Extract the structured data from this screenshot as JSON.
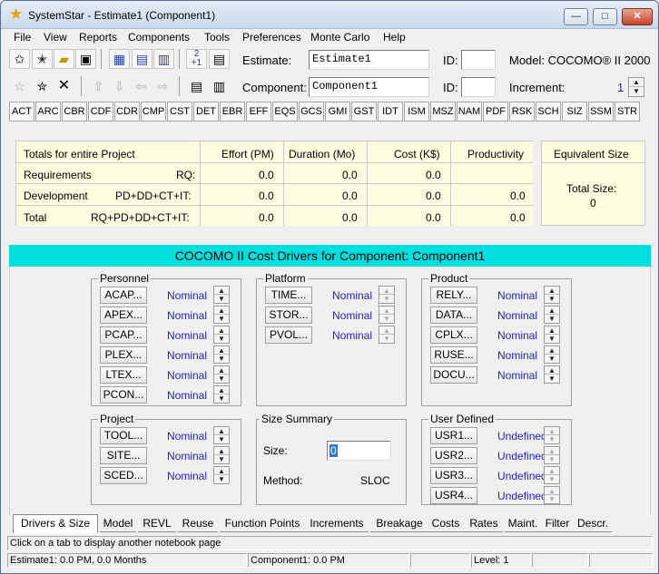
{
  "window": {
    "title": "SystemStar - Estimate1 (Component1)"
  },
  "menu": [
    "File",
    "View",
    "Reports",
    "Components",
    "Tools",
    "Preferences",
    "Monte Carlo",
    "Help"
  ],
  "header": {
    "estimate_label": "Estimate:",
    "estimate_value": "Estimate1",
    "id_label": "ID:",
    "id_value": "",
    "model_label": "Model: COCOMO® II 2000",
    "component_label": "Component:",
    "component_value": "Component1",
    "id2_label": "ID:",
    "id2_value": "",
    "increment_label": "Increment:",
    "increment_value": "1"
  },
  "toolbar_icons": [
    "new-estimate-icon",
    "new-component-icon",
    "open-folder-icon",
    "save-icon",
    "spreadsheet-icon",
    "window-list-icon",
    "window-tile-icon",
    "increment-icon",
    "report-icon",
    "star-icon",
    "add-component-icon",
    "delete-icon",
    "move-up-icon",
    "move-down-icon",
    "move-left-icon",
    "move-right-icon",
    "print-preview-icon",
    "print-icon"
  ],
  "increment_icon_text": {
    "top": "2",
    "bottom": "+1"
  },
  "abbr_buttons": [
    "ACT",
    "ARC",
    "CBR",
    "CDF",
    "CDR",
    "CMP",
    "CST",
    "DET",
    "EBR",
    "EFF",
    "EQS",
    "GCS",
    "GMI",
    "GST",
    "IDT",
    "ISM",
    "MSZ",
    "NAM",
    "PDF",
    "RSK",
    "SCH",
    "SIZ",
    "SSM",
    "STR"
  ],
  "totals": {
    "header": [
      "Totals for entire Project",
      "Effort (PM)",
      "Duration (Mo)",
      "Cost (K$)",
      "Productivity"
    ],
    "rows": [
      {
        "name": "Requirements",
        "code": "RQ:",
        "effort": "0.0",
        "duration": "0.0",
        "cost": "0.0",
        "productivity": ""
      },
      {
        "name": "Development",
        "code": "PD+DD+CT+IT:",
        "effort": "0.0",
        "duration": "0.0",
        "cost": "0.0",
        "productivity": "0.0"
      },
      {
        "name": "Total",
        "code": "RQ+PD+DD+CT+IT:",
        "effort": "0.0",
        "duration": "0.0",
        "cost": "0.0",
        "productivity": "0.0"
      }
    ],
    "equivalent_size_header": "Equivalent Size",
    "total_size_label": "Total Size:",
    "total_size_value": "0"
  },
  "drivers_title": "COCOMO II Cost Drivers for Component: Component1",
  "groups": {
    "personnel": {
      "title": "Personnel",
      "items": [
        {
          "label": "ACAP...",
          "value": "Nominal"
        },
        {
          "label": "APEX...",
          "value": "Nominal"
        },
        {
          "label": "PCAP...",
          "value": "Nominal"
        },
        {
          "label": "PLEX...",
          "value": "Nominal"
        },
        {
          "label": "LTEX...",
          "value": "Nominal"
        },
        {
          "label": "PCON...",
          "value": "Nominal"
        }
      ]
    },
    "platform": {
      "title": "Platform",
      "items": [
        {
          "label": "TIME...",
          "value": "Nominal"
        },
        {
          "label": "STOR...",
          "value": "Nominal"
        },
        {
          "label": "PVOL...",
          "value": "Nominal"
        }
      ]
    },
    "product": {
      "title": "Product",
      "items": [
        {
          "label": "RELY...",
          "value": "Nominal"
        },
        {
          "label": "DATA...",
          "value": "Nominal"
        },
        {
          "label": "CPLX...",
          "value": "Nominal"
        },
        {
          "label": "RUSE...",
          "value": "Nominal"
        },
        {
          "label": "DOCU...",
          "value": "Nominal"
        }
      ]
    },
    "project": {
      "title": "Project",
      "items": [
        {
          "label": "TOOL...",
          "value": "Nominal"
        },
        {
          "label": "SITE...",
          "value": "Nominal"
        },
        {
          "label": "SCED...",
          "value": "Nominal"
        }
      ]
    },
    "size_summary": {
      "title": "Size Summary",
      "size_label": "Size:",
      "size_value": "0",
      "method_label": "Method:",
      "method_value": "SLOC"
    },
    "user_defined": {
      "title": "User Defined",
      "items": [
        {
          "label": "USR1...",
          "value": "Undefined"
        },
        {
          "label": "USR2...",
          "value": "Undefined"
        },
        {
          "label": "USR3...",
          "value": "Undefined"
        },
        {
          "label": "USR4...",
          "value": "Undefined"
        }
      ]
    }
  },
  "tabs": [
    "Drivers & Size",
    "Model",
    "REVL",
    "Reuse",
    "Function Points",
    "Increments",
    "Breakage",
    "Costs",
    "Rates",
    "Maint.",
    "Filter",
    "Descr."
  ],
  "status": {
    "hint": "Click on a tab to display another notebook page",
    "estimate": "Estimate1:  0.0 PM,  0.0 Months",
    "component": "Component1:  0.0 PM",
    "level_label": "Level:",
    "level_value": "1"
  },
  "colors": {
    "accent_cyan": "#00dede",
    "value_blue": "#1f1fc8",
    "table_yellow": "#fffde0"
  }
}
